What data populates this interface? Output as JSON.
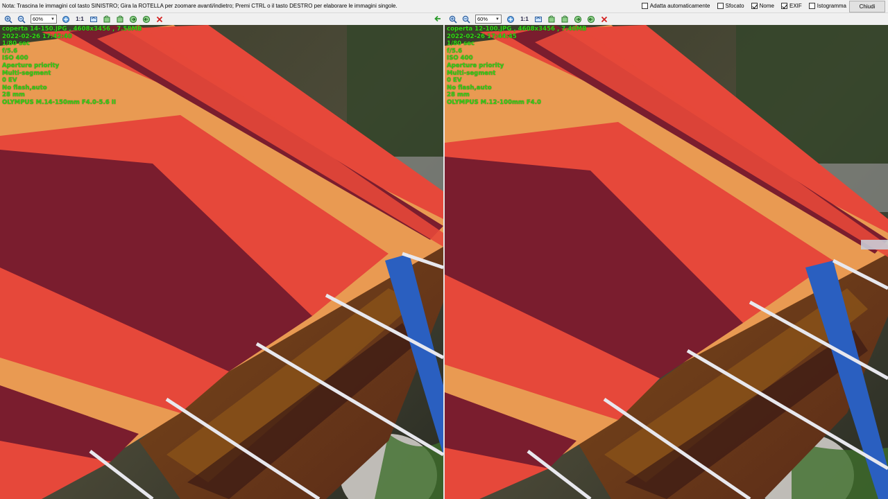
{
  "topbar": {
    "note": "Nota: Trascina le immagini col tasto SINISTRO; Gira la ROTELLA per zoomare avanti/indietro; Premi CTRL o il tasto DESTRO per elaborare le immagini singole.",
    "options": [
      {
        "label": "Adatta automaticamente",
        "checked": false
      },
      {
        "label": "Sfocato",
        "checked": false
      },
      {
        "label": "Nome",
        "checked": true
      },
      {
        "label": "EXIF",
        "checked": true
      },
      {
        "label": "Istogramma",
        "checked": false
      }
    ],
    "close_label": "Chiudi"
  },
  "toolbar": {
    "zoom_value": "60%",
    "one_to_one": "1:1",
    "icons": [
      "zoom-in-icon",
      "zoom-out-icon",
      "zoom-select",
      "pan-icon",
      "one-to-one",
      "fit-icon",
      "rotate-left-icon",
      "rotate-right-icon",
      "next-icon",
      "prev-icon",
      "close-image-icon"
    ],
    "back_icon": "back-arrow-icon"
  },
  "colors": {
    "exif_text": "#32d616",
    "stripe_red": "#e6483a",
    "stripe_orange": "#e99a52",
    "stripe_maroon": "#7a1d2e",
    "rack_blue": "#2a5fc0"
  },
  "left_image": {
    "exif": [
      "coperta 14-150.JPG , 4608x3456 , 7.58MB",
      "2022-02-26 17:42:40",
      "1/80 sec",
      "f/5.6",
      "ISO 400",
      "Aperture priority",
      "Multi-segment",
      "0 EV",
      "No flash,auto",
      "28 mm",
      "OLYMPUS M.14-150mm F4.0-5.6 II"
    ]
  },
  "right_image": {
    "exif": [
      "coperta 12-100.JPG , 4608x3456 , 7.40MB",
      "2022-02-26 17:44:45",
      "1/80 sec",
      "f/5.6",
      "ISO 400",
      "Aperture priority",
      "Multi-segment",
      "0 EV",
      "No flash,auto",
      "28 mm",
      "OLYMPUS M.12-100mm F4.0"
    ]
  }
}
